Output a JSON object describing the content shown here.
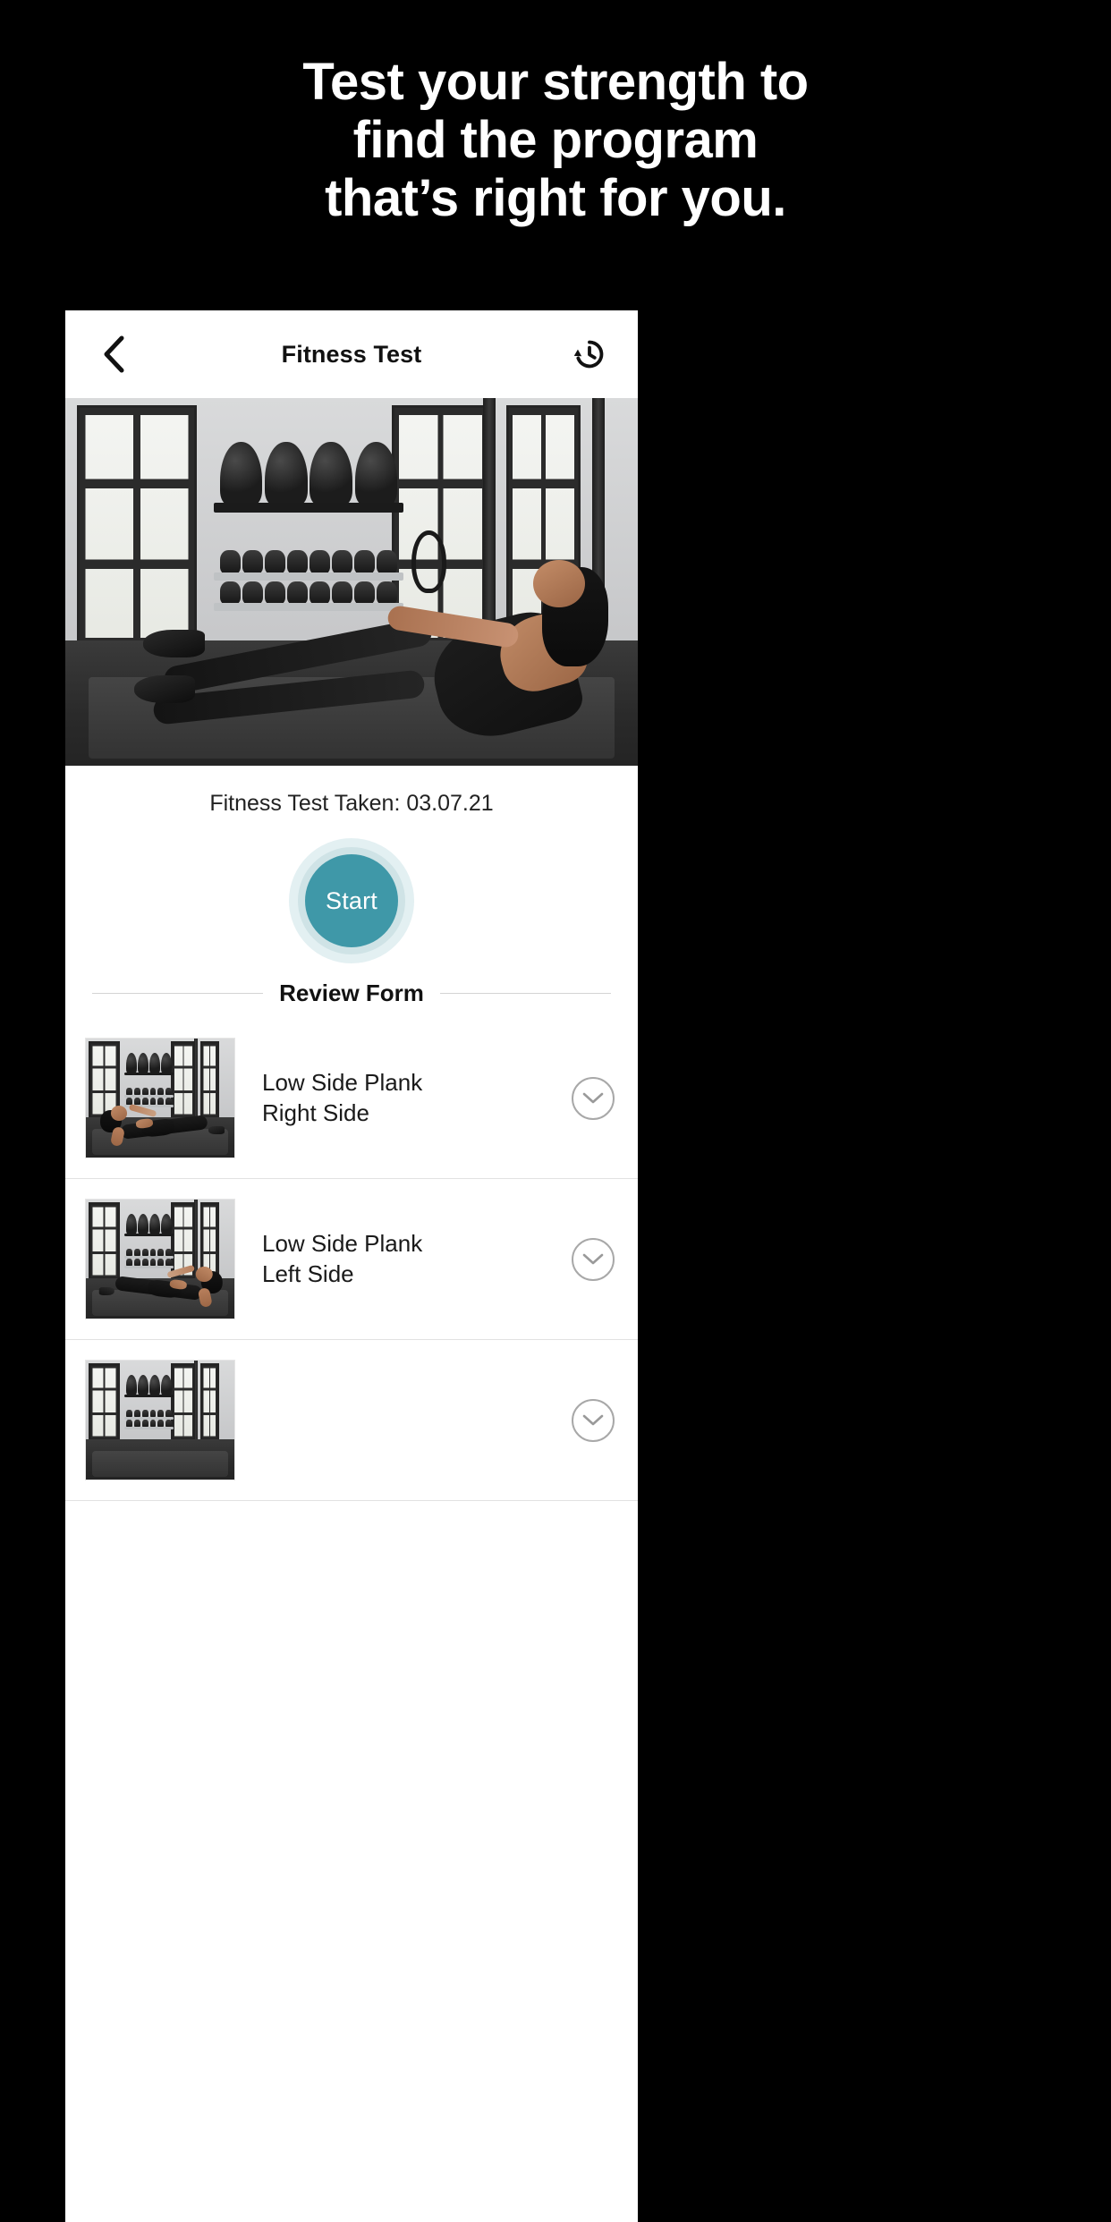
{
  "promo": {
    "headline_lines": [
      "Test your strength to",
      "find the program",
      "that’s right for you."
    ]
  },
  "app": {
    "header": {
      "back_icon": "chevron-left-icon",
      "title": "Fitness Test",
      "history_icon": "history-clock-icon"
    },
    "hero": {
      "alt": "woman performing seated v-hold on mat in gym"
    },
    "test_status": {
      "taken_label": "Fitness Test Taken: 03.07.21"
    },
    "start_button": {
      "label": "Start",
      "fill_color": "#3f98a8",
      "ring_color": "#cfe3e6",
      "halo_color": "#e3f0f2"
    },
    "review_section": {
      "label": "Review Form"
    },
    "exercises": [
      {
        "name_line1": "Low Side Plank",
        "name_line2": "Right Side",
        "expand_icon": "chevron-down-circle-icon",
        "thumbnail_alt": "low side plank right side"
      },
      {
        "name_line1": "Low Side Plank",
        "name_line2": "Left Side",
        "expand_icon": "chevron-down-circle-icon",
        "thumbnail_alt": "low side plank left side"
      },
      {
        "name_line1": "",
        "name_line2": "",
        "expand_icon": "chevron-down-circle-icon",
        "thumbnail_alt": "next exercise partially visible"
      }
    ]
  },
  "colors": {
    "background": "#000000",
    "card": "#ffffff",
    "accent": "#3f98a8",
    "divider": "#e2e2e2"
  }
}
